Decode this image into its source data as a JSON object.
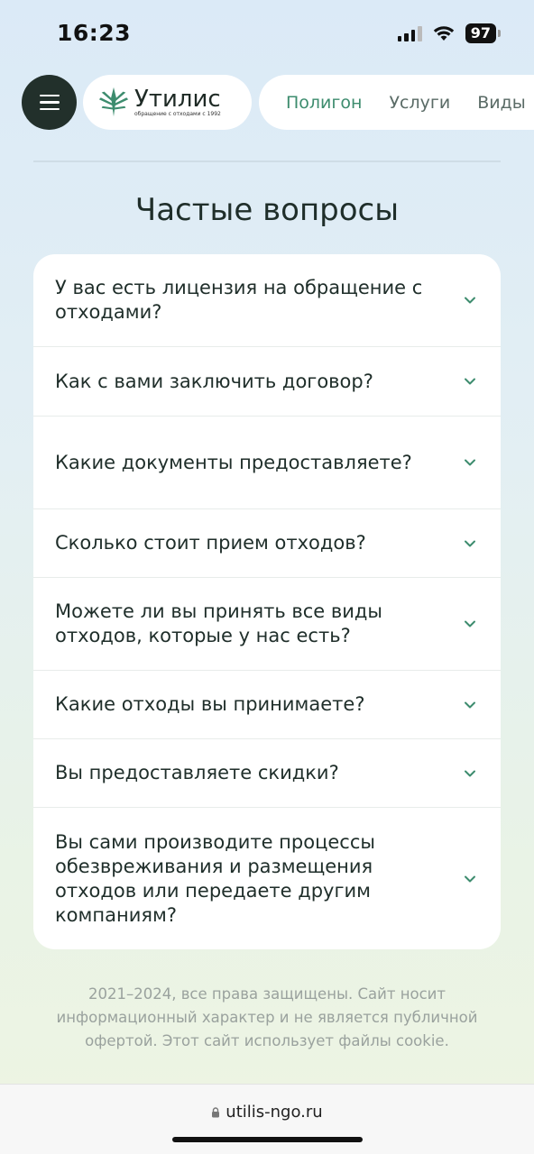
{
  "status": {
    "time": "16:23",
    "battery": "97"
  },
  "nav": {
    "logo_name": "Утилис",
    "logo_tagline": "обращение с отходами с 1992",
    "tabs": [
      "Полигон",
      "Услуги",
      "Виды"
    ]
  },
  "page_title": "Частые вопросы",
  "faq": [
    "У вас есть лицензия на обращение с отходами?",
    "Как с вами заключить договор?",
    "Какие документы предоставляете?",
    "Сколько стоит прием отходов?",
    "Можете ли вы принять все виды отходов, которые у нас есть?",
    "Какие отходы вы принимаете?",
    "Вы предоставляете скидки?",
    "Вы сами производите процессы обезвреживания и размещения отходов или передаете другим компаниям?"
  ],
  "footer": "2021–2024, все права защищены. Сайт носит информационный характер и не является публичной офертой. Этот сайт использует файлы cookie.",
  "url": "utilis-ngo.ru",
  "colors": {
    "accent": "#3d8c6e",
    "dark": "#22302b"
  }
}
